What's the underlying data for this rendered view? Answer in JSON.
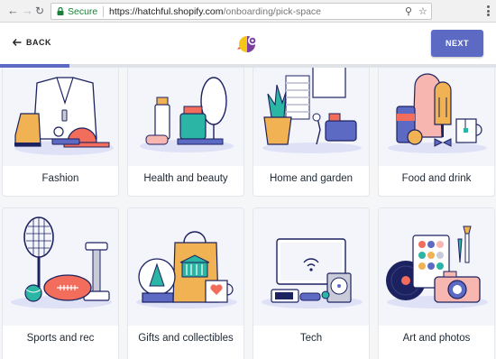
{
  "browser": {
    "secure_label": "Secure",
    "url_host": "https://hatchful.shopify.com",
    "url_path": "/onboarding/pick-space"
  },
  "header": {
    "back_label": "BACK",
    "next_label": "NEXT",
    "progress_fraction": 0.14
  },
  "categories": [
    {
      "label": "Fashion",
      "icon": "fashion-illustration"
    },
    {
      "label": "Health and beauty",
      "icon": "health-beauty-illustration"
    },
    {
      "label": "Home and garden",
      "icon": "home-garden-illustration"
    },
    {
      "label": "Food and drink",
      "icon": "food-drink-illustration"
    },
    {
      "label": "Sports and rec",
      "icon": "sports-illustration"
    },
    {
      "label": "Gifts and collectibles",
      "icon": "gifts-illustration"
    },
    {
      "label": "Tech",
      "icon": "tech-illustration"
    },
    {
      "label": "Art and photos",
      "icon": "art-photos-illustration"
    }
  ],
  "colors": {
    "accent": "#5c6ac4",
    "secure": "#188038"
  }
}
